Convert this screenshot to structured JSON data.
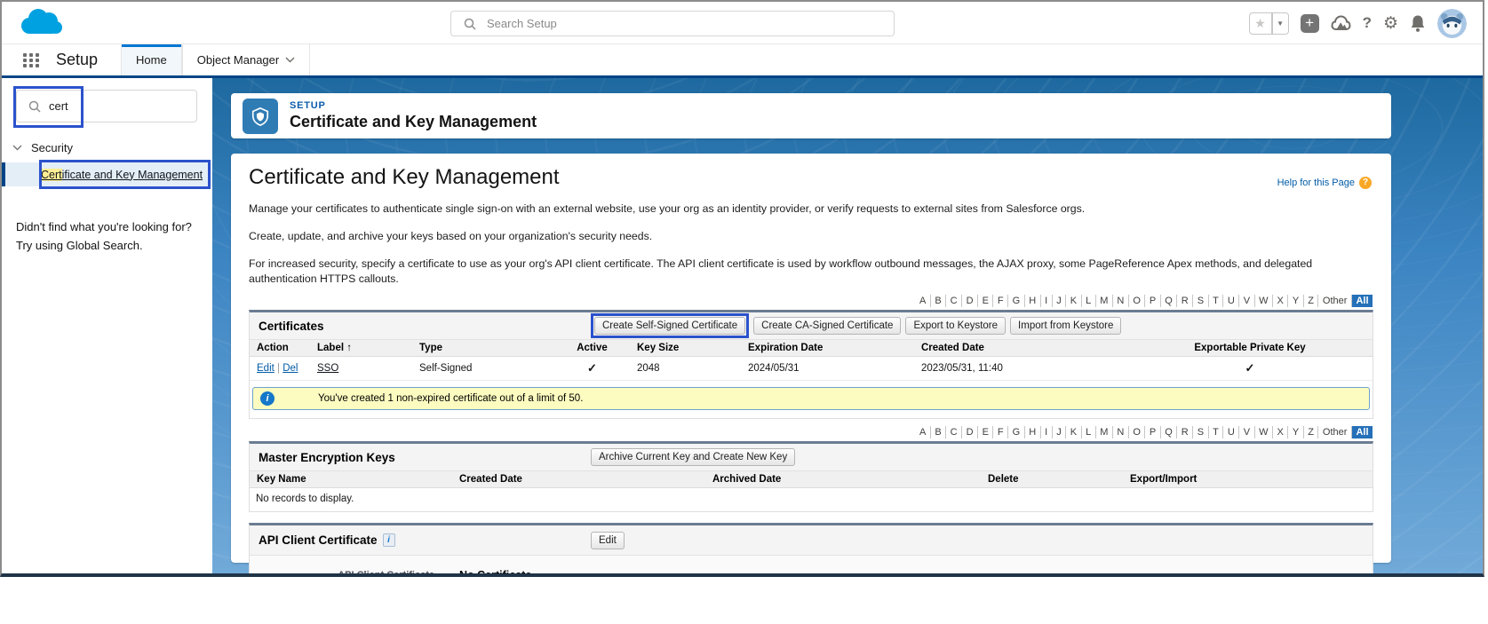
{
  "colors": {
    "annotation": "#2b52cc",
    "brand-blue": "#00a1e0",
    "nav-underline": "#014486",
    "link": "#015ba7",
    "section-bar": "#6b7c92",
    "info-bg": "#fcfcc0",
    "alpha-selected-bg": "#2570b8"
  },
  "global_header": {
    "search_placeholder": "Search Setup"
  },
  "nav": {
    "app_label": "Setup",
    "tabs": [
      {
        "label": "Home"
      },
      {
        "label": "Object Manager"
      }
    ]
  },
  "sidebar": {
    "search_value": "cert",
    "group_label": "Security",
    "selected_item_highlight": "Cert",
    "selected_item_rest": "ificate and Key Management",
    "footer_line1": "Didn't find what you're looking for?",
    "footer_line2": "Try using Global Search."
  },
  "page_header": {
    "eyebrow": "SETUP",
    "title": "Certificate and Key Management"
  },
  "content": {
    "title": "Certificate and Key Management",
    "help_link": "Help for this Page",
    "help_badge": "?",
    "paragraphs": [
      "Manage your certificates to authenticate single sign-on with an external website, use your org as an identity provider, or verify requests to external sites from Salesforce orgs.",
      "Create, update, and archive your keys based on your organization's security needs.",
      "For increased security, specify a certificate to use as your org's API client certificate. The API client certificate is used by workflow outbound messages, the AJAX proxy, some PageReference Apex methods, and delegated authentication HTTPS callouts."
    ],
    "alphabet": [
      "A",
      "B",
      "C",
      "D",
      "E",
      "F",
      "G",
      "H",
      "I",
      "J",
      "K",
      "L",
      "M",
      "N",
      "O",
      "P",
      "Q",
      "R",
      "S",
      "T",
      "U",
      "V",
      "W",
      "X",
      "Y",
      "Z",
      "Other",
      "All"
    ],
    "alphabet_selected": "All",
    "certificates": {
      "title": "Certificates",
      "buttons": [
        "Create Self-Signed Certificate",
        "Create CA-Signed Certificate",
        "Export to Keystore",
        "Import from Keystore"
      ],
      "columns": [
        "Action",
        "Label",
        "Type",
        "Active",
        "Key Size",
        "Expiration Date",
        "Created Date",
        "Exportable Private Key"
      ],
      "sort_indicator": "↑",
      "row": {
        "action_edit": "Edit",
        "action_del": "Del",
        "label": "SSO",
        "type": "Self-Signed",
        "active": "✓",
        "key_size": "2048",
        "expiration_date": "2024/05/31",
        "created_date": "2023/05/31, 11:40",
        "exportable": "✓"
      },
      "info_message": "You've created 1 non-expired certificate out of a limit of 50.",
      "info_icon": "i"
    },
    "master_keys": {
      "title": "Master Encryption Keys",
      "button": "Archive Current Key and Create New Key",
      "columns": [
        "Key Name",
        "Created Date",
        "Archived Date",
        "Delete",
        "Export/Import"
      ],
      "empty_text": "No records to display."
    },
    "api_cert": {
      "title": "API Client Certificate",
      "info_icon": "i",
      "button": "Edit",
      "field_label": "API Client Certificate",
      "field_value": "No Certificate"
    }
  }
}
